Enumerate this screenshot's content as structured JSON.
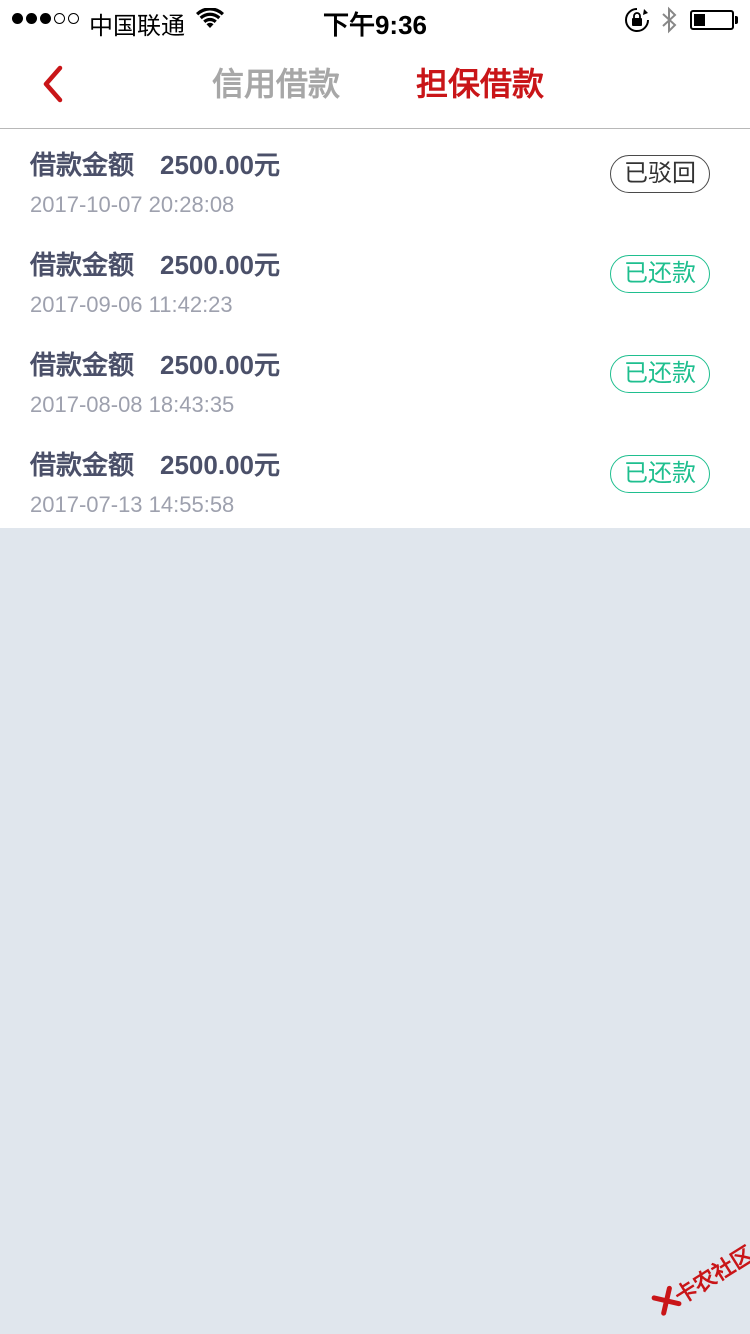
{
  "status_bar": {
    "carrier": "中国联通",
    "time": "下午9:36",
    "signal_bars_filled": 3,
    "signal_bars_total": 5,
    "battery_level": 0.3,
    "icons": [
      "wifi-icon",
      "rotation-lock-icon",
      "bluetooth-icon",
      "battery-icon"
    ]
  },
  "nav": {
    "back_icon": "chevron-left-icon",
    "tabs": [
      {
        "label": "信用借款",
        "active": false
      },
      {
        "label": "担保借款",
        "active": true
      }
    ]
  },
  "loans": [
    {
      "title": "借款金额",
      "amount": "2500.00元",
      "date": "2017-10-07 20:28:08",
      "status": "已驳回",
      "status_type": "rejected"
    },
    {
      "title": "借款金额",
      "amount": "2500.00元",
      "date": "2017-09-06 11:42:23",
      "status": "已还款",
      "status_type": "repaid"
    },
    {
      "title": "借款金额",
      "amount": "2500.00元",
      "date": "2017-08-08 18:43:35",
      "status": "已还款",
      "status_type": "repaid"
    },
    {
      "title": "借款金额",
      "amount": "2500.00元",
      "date": "2017-07-13 14:55:58",
      "status": "已还款",
      "status_type": "repaid"
    }
  ],
  "watermark": {
    "text": "卡农社区"
  },
  "colors": {
    "accent": "#c91518",
    "repaid": "#1fbf8f",
    "rejected": "#4a4a4a",
    "text_primary": "#4b5069",
    "text_secondary": "#9ea1ae",
    "tab_inactive": "#a7a7a7",
    "page_bg": "#e0e6ed"
  }
}
